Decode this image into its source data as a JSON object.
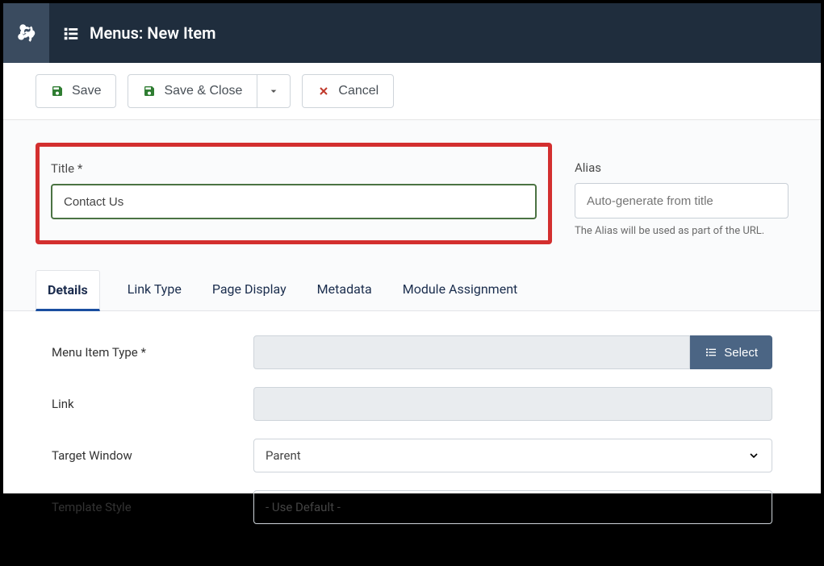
{
  "header": {
    "title": "Menus: New Item"
  },
  "toolbar": {
    "save_label": "Save",
    "save_close_label": "Save & Close",
    "cancel_label": "Cancel"
  },
  "meta": {
    "title_label": "Title *",
    "title_value": "Contact Us",
    "alias_label": "Alias",
    "alias_placeholder": "Auto-generate from title",
    "alias_helper": "The Alias will be used as part of the URL."
  },
  "tabs": [
    {
      "label": "Details",
      "active": true
    },
    {
      "label": "Link Type",
      "active": false
    },
    {
      "label": "Page Display",
      "active": false
    },
    {
      "label": "Metadata",
      "active": false
    },
    {
      "label": "Module Assignment",
      "active": false
    }
  ],
  "form": {
    "menu_item_type_label": "Menu Item Type *",
    "menu_item_type_value": "",
    "select_button_label": "Select",
    "link_label": "Link",
    "link_value": "",
    "target_window_label": "Target Window",
    "target_window_value": "Parent",
    "template_style_label": "Template Style",
    "template_style_value": "- Use Default -"
  }
}
